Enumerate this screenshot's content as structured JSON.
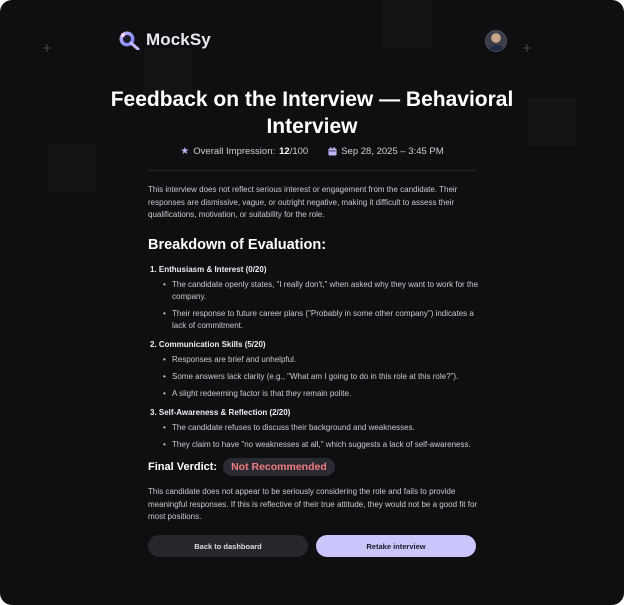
{
  "app": {
    "name": "MockSy"
  },
  "header": {
    "title": "Feedback on the Interview — Behavioral Interview"
  },
  "meta": {
    "impression_label": "Overall Impression:",
    "score": "12",
    "score_total": "/100",
    "date": "Sep 28, 2025 – 3:45 PM"
  },
  "summary": "This interview does not reflect serious interest or engagement from the candidate. Their responses are dismissive, vague, or outright negative, making it difficult to assess their qualifications, motivation, or suitability for the role.",
  "breakdown": {
    "heading": "Breakdown of Evaluation:",
    "categories": [
      {
        "title": "1. Enthusiasm & Interest (0/20)",
        "points": [
          "The candidate openly states, \"I really don't,\" when asked why they want to work for the company.",
          "Their response to future career plans (\"Probably in some other company\") indicates a lack of commitment."
        ]
      },
      {
        "title": "2. Communication Skills (5/20)",
        "points": [
          "Responses are brief and unhelpful.",
          "Some answers lack clarity (e.g., \"What am I going to do in this role at this role?\").",
          "A slight redeeming factor is that they remain polite."
        ]
      },
      {
        "title": "3. Self-Awareness & Reflection (2/20)",
        "points": [
          "The candidate refuses to discuss their background and weaknesses.",
          "They claim to have \"no weaknesses at all,\" which suggests a lack of self-awareness."
        ]
      }
    ]
  },
  "verdict": {
    "label": "Final Verdict:",
    "value": "Not Recommended",
    "color": "#f07c7c"
  },
  "closing": "This candidate does not appear to be seriously considering the role and fails to provide meaningful responses. If this is reflective of their true attitude, they would not be a good fit for most positions.",
  "actions": {
    "back_label": "Back to dashboard",
    "retake_label": "Retake interview"
  },
  "colors": {
    "background": "#0f0f12",
    "accent": "#cac5fb"
  }
}
